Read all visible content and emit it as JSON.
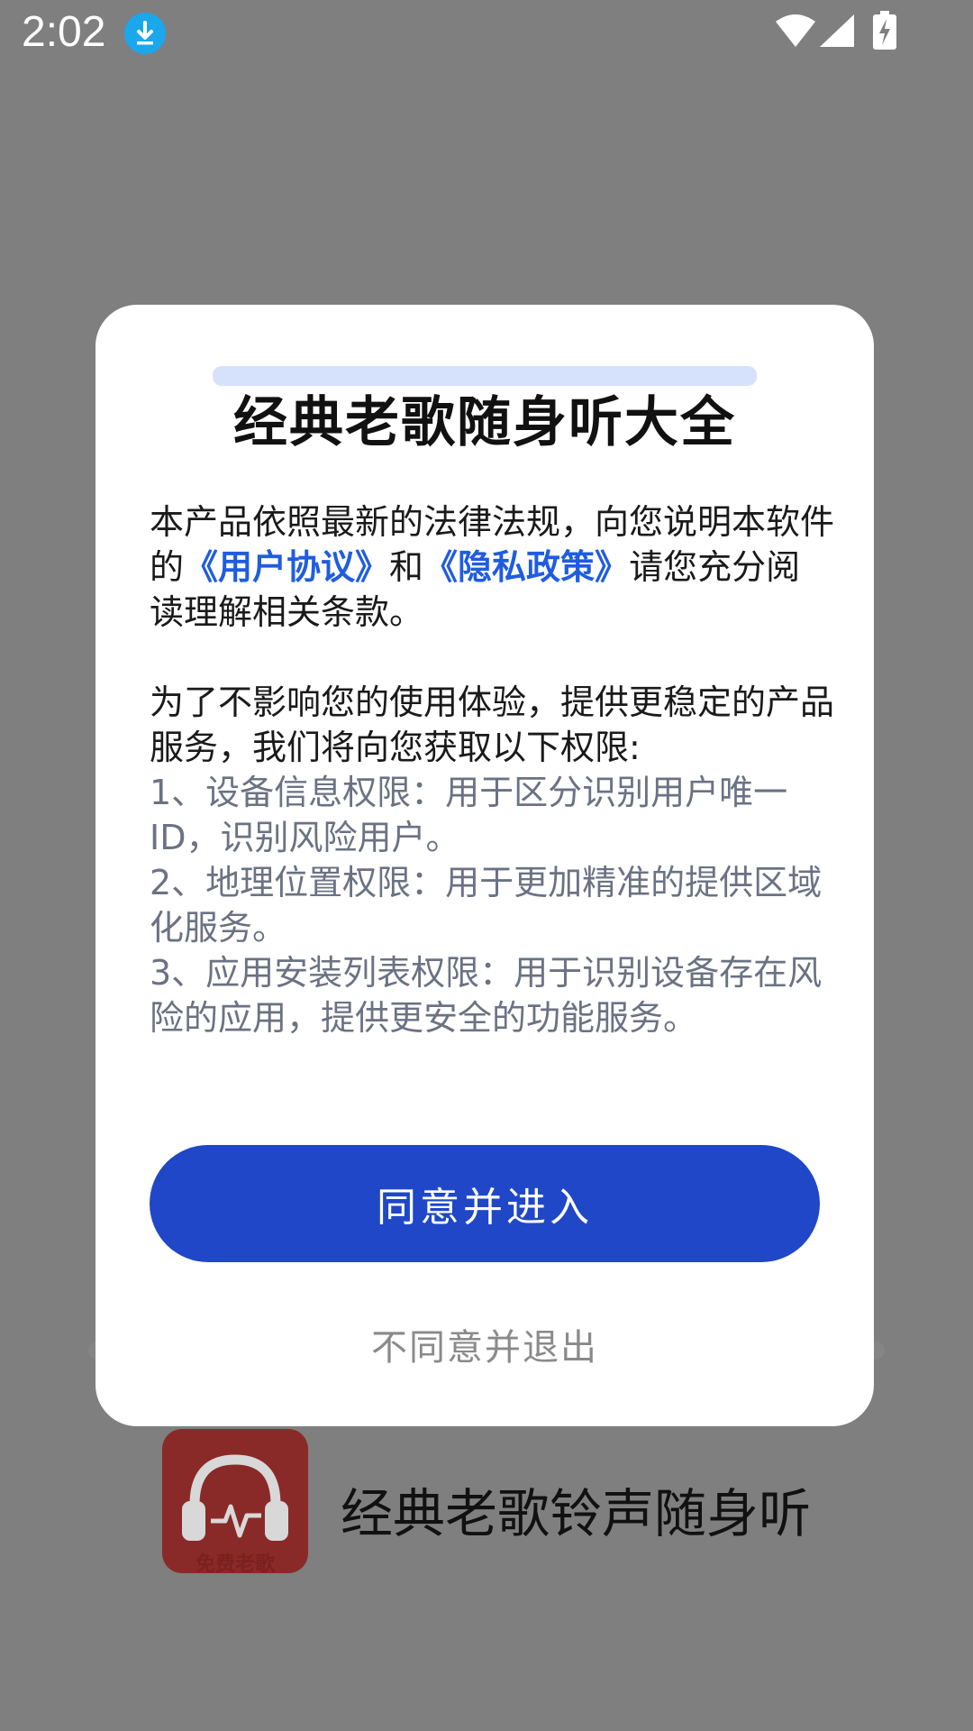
{
  "status_bar": {
    "time": "2:02",
    "icons": [
      "download-icon",
      "wifi-icon",
      "signal-icon",
      "battery-charging-icon"
    ]
  },
  "background": {
    "app_logo_text": "免费老歌",
    "app_name": "经典老歌铃声随身听"
  },
  "dialog": {
    "title": "经典老歌随身听大全",
    "intro_part1": "本产品依照最新的法律法规，向您说明本软件的",
    "link_user_agreement": "《用户协议》",
    "conj": "和",
    "link_privacy_policy": "《隐私政策》",
    "intro_part2": "请您充分阅读理解相关条款。",
    "permission_intro": "为了不影响您的使用体验，提供更稳定的产品服务，我们将向您获取以下权限:",
    "permissions": [
      "1、设备信息权限：用于区分识别用户唯一ID，识别风险用户。",
      "2、地理位置权限：用于更加精准的提供区域化服务。",
      "3、应用安装列表权限：用于识别设备存在风险的应用，提供更安全的功能服务。"
    ],
    "agree_button": "同意并进入",
    "disagree_button": "不同意并退出"
  },
  "colors": {
    "accent": "#1f47c8",
    "link": "#1f5de0",
    "overlay": "#7f7f7f"
  }
}
